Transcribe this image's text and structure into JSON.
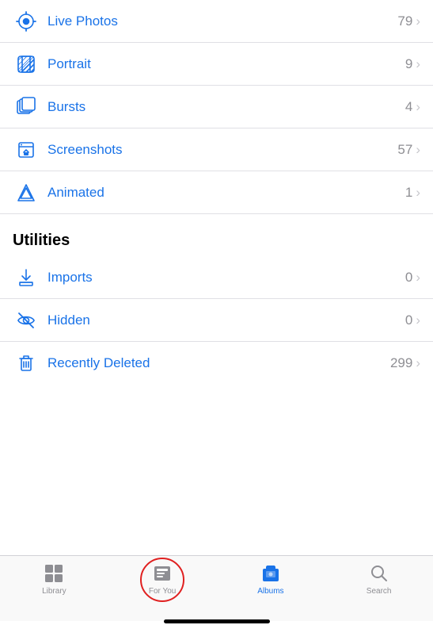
{
  "items": [
    {
      "id": "live-photos",
      "label": "Live Photos",
      "count": "79",
      "icon": "live-photos"
    },
    {
      "id": "portrait",
      "label": "Portrait",
      "count": "9",
      "icon": "portrait"
    },
    {
      "id": "bursts",
      "label": "Bursts",
      "count": "4",
      "icon": "bursts"
    },
    {
      "id": "screenshots",
      "label": "Screenshots",
      "count": "57",
      "icon": "screenshots"
    },
    {
      "id": "animated",
      "label": "Animated",
      "count": "1",
      "icon": "animated"
    }
  ],
  "utilities_header": "Utilities",
  "utilities_items": [
    {
      "id": "imports",
      "label": "Imports",
      "count": "0",
      "icon": "imports"
    },
    {
      "id": "hidden",
      "label": "Hidden",
      "count": "0",
      "icon": "hidden"
    },
    {
      "id": "recently-deleted",
      "label": "Recently Deleted",
      "count": "299",
      "icon": "trash"
    }
  ],
  "tabs": [
    {
      "id": "library",
      "label": "Library",
      "active": false
    },
    {
      "id": "for-you",
      "label": "For You",
      "active": false,
      "circled": true
    },
    {
      "id": "albums",
      "label": "Albums",
      "active": true
    },
    {
      "id": "search",
      "label": "Search",
      "active": false
    }
  ]
}
